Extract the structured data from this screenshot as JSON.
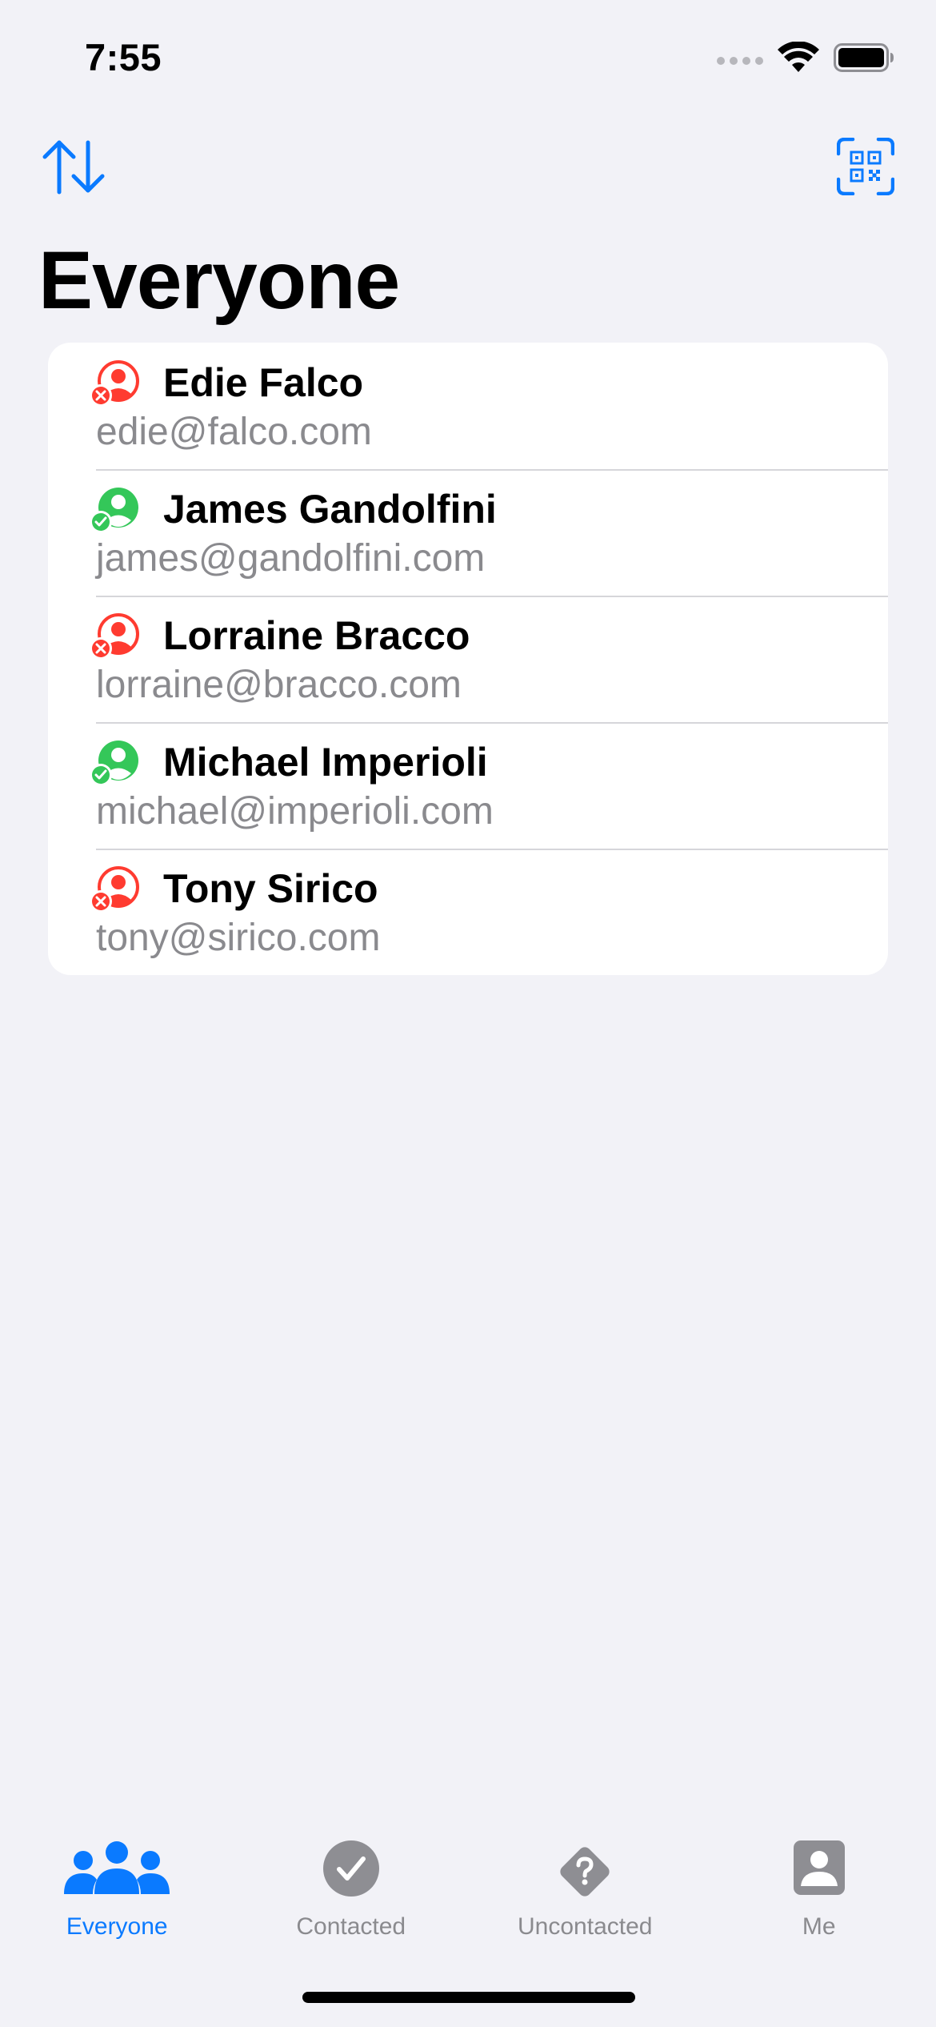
{
  "status_bar": {
    "time": "7:55",
    "signal_icon": "cellular-dots-icon",
    "wifi_icon": "wifi-icon",
    "battery_icon": "battery-full-icon"
  },
  "nav": {
    "left_icon": "sort-arrows-icon",
    "right_icon": "qr-code-scan-icon",
    "title": "Everyone"
  },
  "colors": {
    "accent": "#0a7aff",
    "contacted": "#34c759",
    "uncontacted": "#ff3b30",
    "secondary_text": "#8a8a8e",
    "background": "#f2f2f7"
  },
  "contacts": [
    {
      "name": "Edie Falco",
      "email": "edie@falco.com",
      "status": "uncontacted",
      "icon": "person-xmark-icon"
    },
    {
      "name": "James Gandolfini",
      "email": "james@gandolfini.com",
      "status": "contacted",
      "icon": "person-checkmark-icon"
    },
    {
      "name": "Lorraine Bracco",
      "email": "lorraine@bracco.com",
      "status": "uncontacted",
      "icon": "person-xmark-icon"
    },
    {
      "name": "Michael Imperioli",
      "email": "michael@imperioli.com",
      "status": "contacted",
      "icon": "person-checkmark-icon"
    },
    {
      "name": "Tony Sirico",
      "email": "tony@sirico.com",
      "status": "uncontacted",
      "icon": "person-xmark-icon"
    }
  ],
  "tabs": [
    {
      "label": "Everyone",
      "icon": "people-group-icon",
      "active": true
    },
    {
      "label": "Contacted",
      "icon": "checkmark-circle-icon",
      "active": false
    },
    {
      "label": "Uncontacted",
      "icon": "questionmark-diamond-icon",
      "active": false
    },
    {
      "label": "Me",
      "icon": "person-square-icon",
      "active": false
    }
  ]
}
